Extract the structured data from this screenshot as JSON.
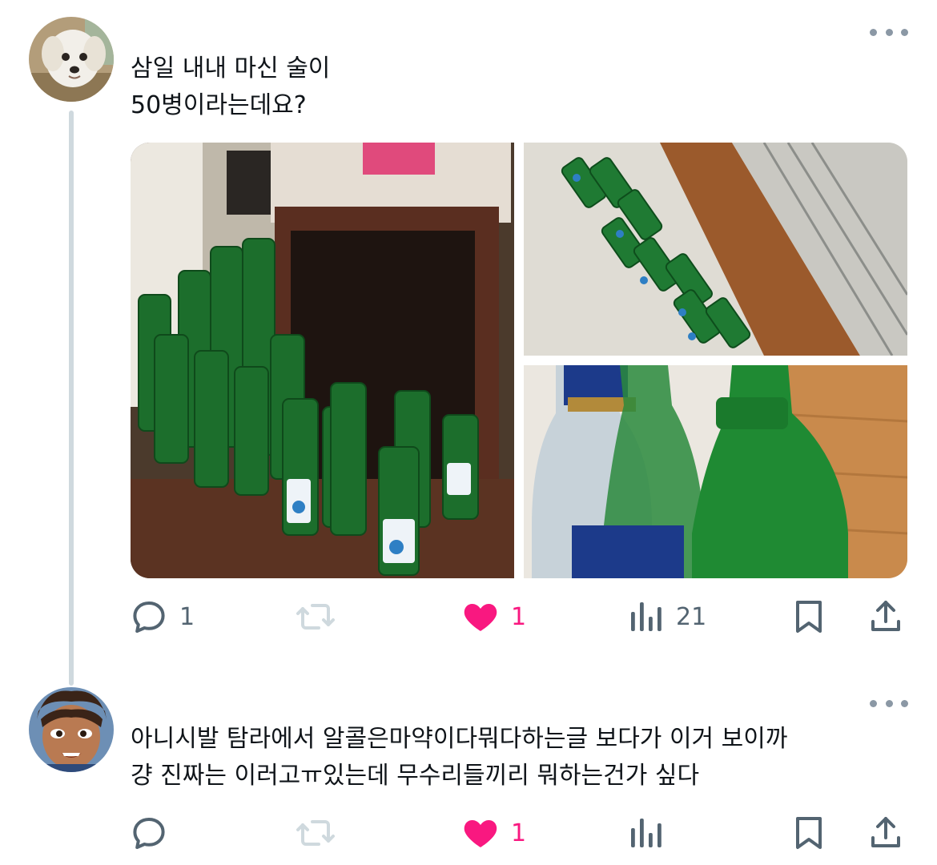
{
  "tweets": [
    {
      "avatar": "dog-avatar",
      "text_lines": [
        "삼일 내내 마신 술이",
        "50병이라는데요?"
      ],
      "media": [
        "photo-green-bottles-table",
        "photo-bottles-on-floor",
        "photo-bottle-necks-closeup"
      ],
      "stats": {
        "replies": "1",
        "retweets": "",
        "likes": "1",
        "views": "21"
      }
    },
    {
      "avatar": "cartoon-avatar",
      "text_lines": [
        "아니시발 탐라에서 알콜은마약이다뭐다하는글 보다가 이거 보이까",
        "걍 진짜는 이러고ㅠ있는데 무수리들끼리 뭐하는건가 싶다"
      ],
      "stats": {
        "replies": "",
        "retweets": "",
        "likes": "1",
        "views": ""
      }
    }
  ],
  "colors": {
    "text": "#0f1419",
    "icon": "#536471",
    "like": "#f91880",
    "thread_line": "#cfd9de",
    "retweet_disabled": "#cfd9de"
  },
  "icons": [
    "reply-icon",
    "retweet-icon",
    "heart-icon",
    "views-icon",
    "bookmark-icon",
    "share-icon",
    "more-icon"
  ]
}
